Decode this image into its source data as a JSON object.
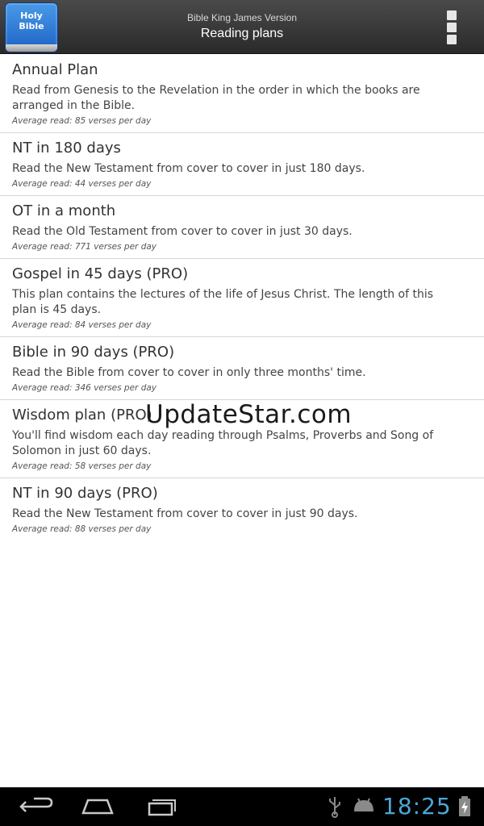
{
  "action_bar": {
    "app_icon_text": [
      "Holy",
      "Bible"
    ],
    "subtitle": "Bible King James Version",
    "title": "Reading plans",
    "overflow_icon": "overflow-menu-icon"
  },
  "plans": [
    {
      "title": "Annual Plan",
      "description": "Read from Genesis to the Revelation in the order in which the books are arranged in the Bible.",
      "average": "Average read: 85 verses per day"
    },
    {
      "title": "NT in 180 days",
      "description": "Read the New Testament from cover to cover in just 180 days.",
      "average": "Average read: 44 verses per day"
    },
    {
      "title": "OT in a month",
      "description": "Read the Old Testament from cover to cover in just 30 days.",
      "average": "Average read: 771 verses per day"
    },
    {
      "title": "Gospel in 45 days (PRO)",
      "description": "This plan contains the lectures of the life of Jesus Christ. The length of this plan is 45 days.",
      "average": "Average read: 84 verses per day"
    },
    {
      "title": "Bible in 90 days (PRO)",
      "description": "Read the Bible from cover to cover in only three months' time.",
      "average": "Average read: 346 verses per day"
    },
    {
      "title": "Wisdom plan (PRO)",
      "description": "You'll find wisdom each day reading through Psalms, Proverbs and Song of Solomon in just 60 days.",
      "average": "Average read: 58 verses per day"
    },
    {
      "title": "NT in 90 days (PRO)",
      "description": "Read the New Testament from cover to cover in just 90 days.",
      "average": "Average read: 88 verses per day"
    }
  ],
  "watermark": "UpdateStar.com",
  "nav_bar": {
    "icons": [
      "back-icon",
      "home-icon",
      "recent-apps-icon",
      "usb-icon",
      "android-icon",
      "battery-charging-icon"
    ],
    "clock": "18:25"
  },
  "colors": {
    "action_bar": "#333333",
    "clock": "#4aa8d8",
    "app_icon": "#2a7ad8"
  }
}
